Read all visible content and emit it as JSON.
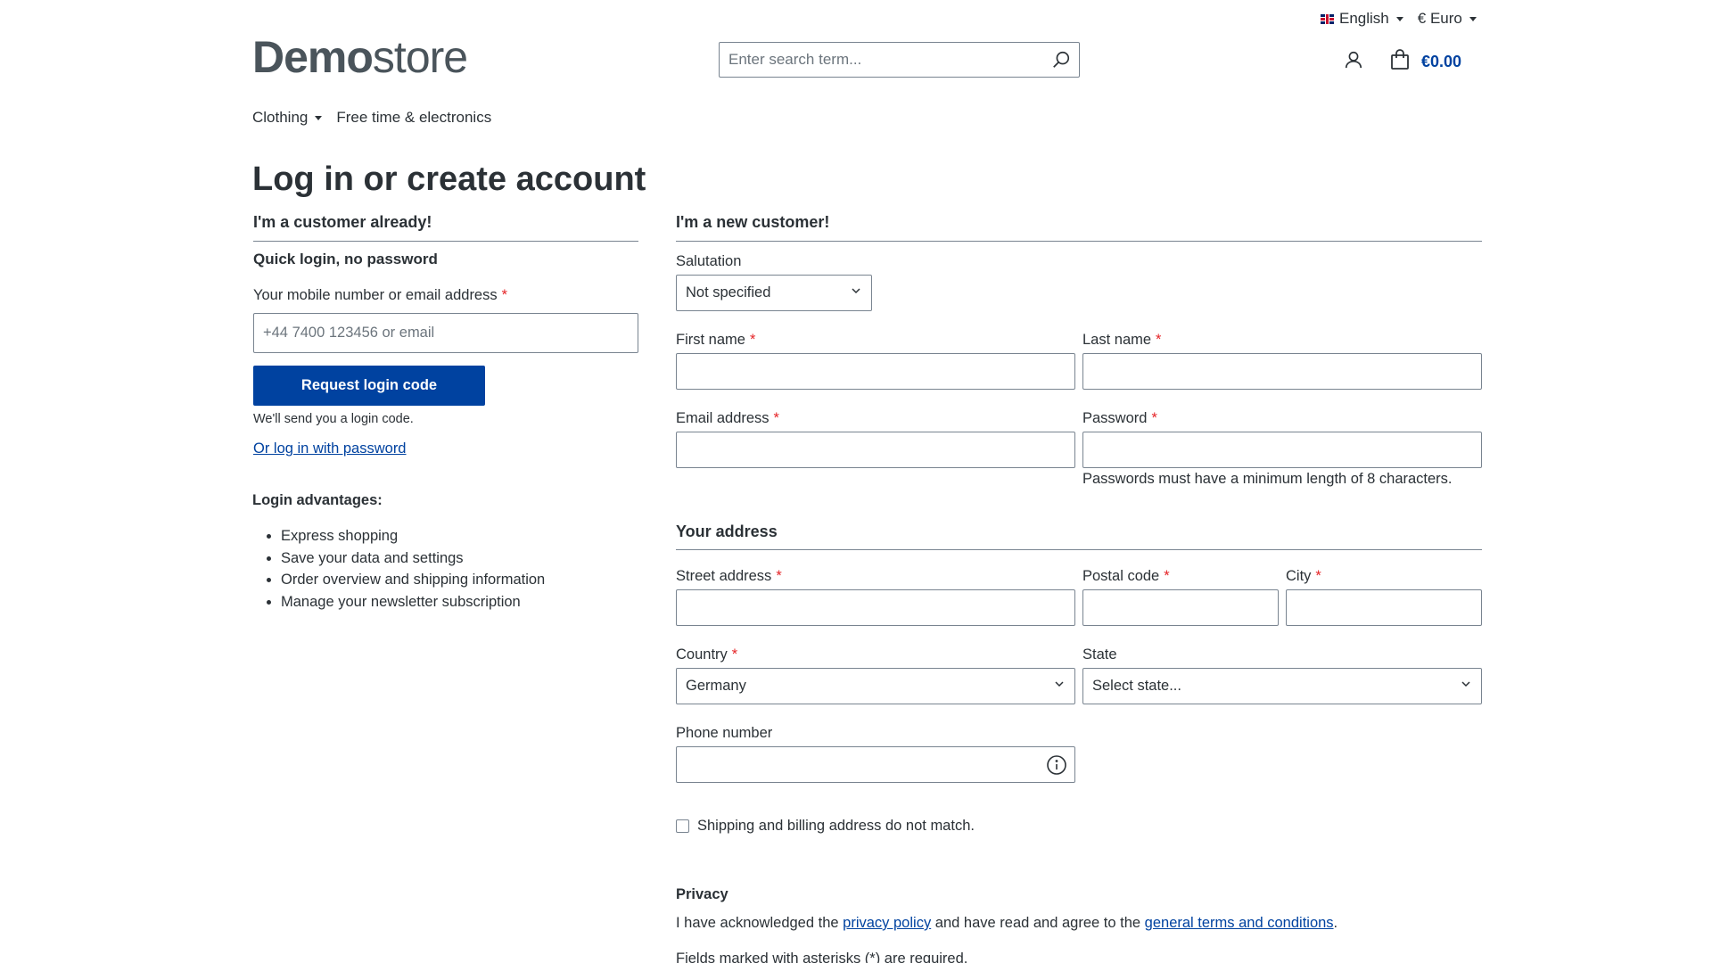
{
  "topbar": {
    "language": "English",
    "currency": "€ Euro"
  },
  "logo": {
    "bold": "Demo",
    "light": "store"
  },
  "search": {
    "placeholder": "Enter search term..."
  },
  "cart": {
    "total": "€0.00"
  },
  "nav": {
    "items": [
      {
        "label": "Clothing",
        "has_dropdown": true
      },
      {
        "label": "Free time & electronics",
        "has_dropdown": false
      }
    ]
  },
  "page": {
    "title": "Log in or create account"
  },
  "login": {
    "heading": "I'm a customer already!",
    "subheading": "Quick login, no password",
    "identifier_label": "Your mobile number or email address",
    "identifier_placeholder": "+44 7400 123456 or email",
    "request_button": "Request login code",
    "hint": "We'll send you a login code.",
    "password_link": "Or log in with password",
    "advantages_heading": "Login advantages:",
    "advantages": [
      "Express shopping",
      "Save your data and settings",
      "Order overview and shipping information",
      "Manage your newsletter subscription"
    ]
  },
  "register": {
    "heading": "I'm a new customer!",
    "salutation_label": "Salutation",
    "salutation_value": "Not specified",
    "first_name_label": "First name",
    "last_name_label": "Last name",
    "email_label": "Email address",
    "password_label": "Password",
    "password_hint": "Passwords must have a minimum length of 8 characters.",
    "address_heading": "Your address",
    "street_label": "Street address",
    "postal_label": "Postal code",
    "city_label": "City",
    "country_label": "Country",
    "country_value": "Germany",
    "state_label": "State",
    "state_value": "Select state...",
    "phone_label": "Phone number",
    "different_address_label": "Shipping and billing address do not match.",
    "privacy_heading": "Privacy",
    "privacy_text_1": "I have acknowledged the",
    "privacy_link": "privacy policy",
    "privacy_text_2": "and have read and agree to the",
    "terms_link": "general terms and conditions",
    "privacy_text_3": ".",
    "required_note": "Fields marked with asterisks (*) are required."
  },
  "colors": {
    "primary": "#0042a0",
    "required": "#e52427",
    "text": "#2b3136"
  }
}
